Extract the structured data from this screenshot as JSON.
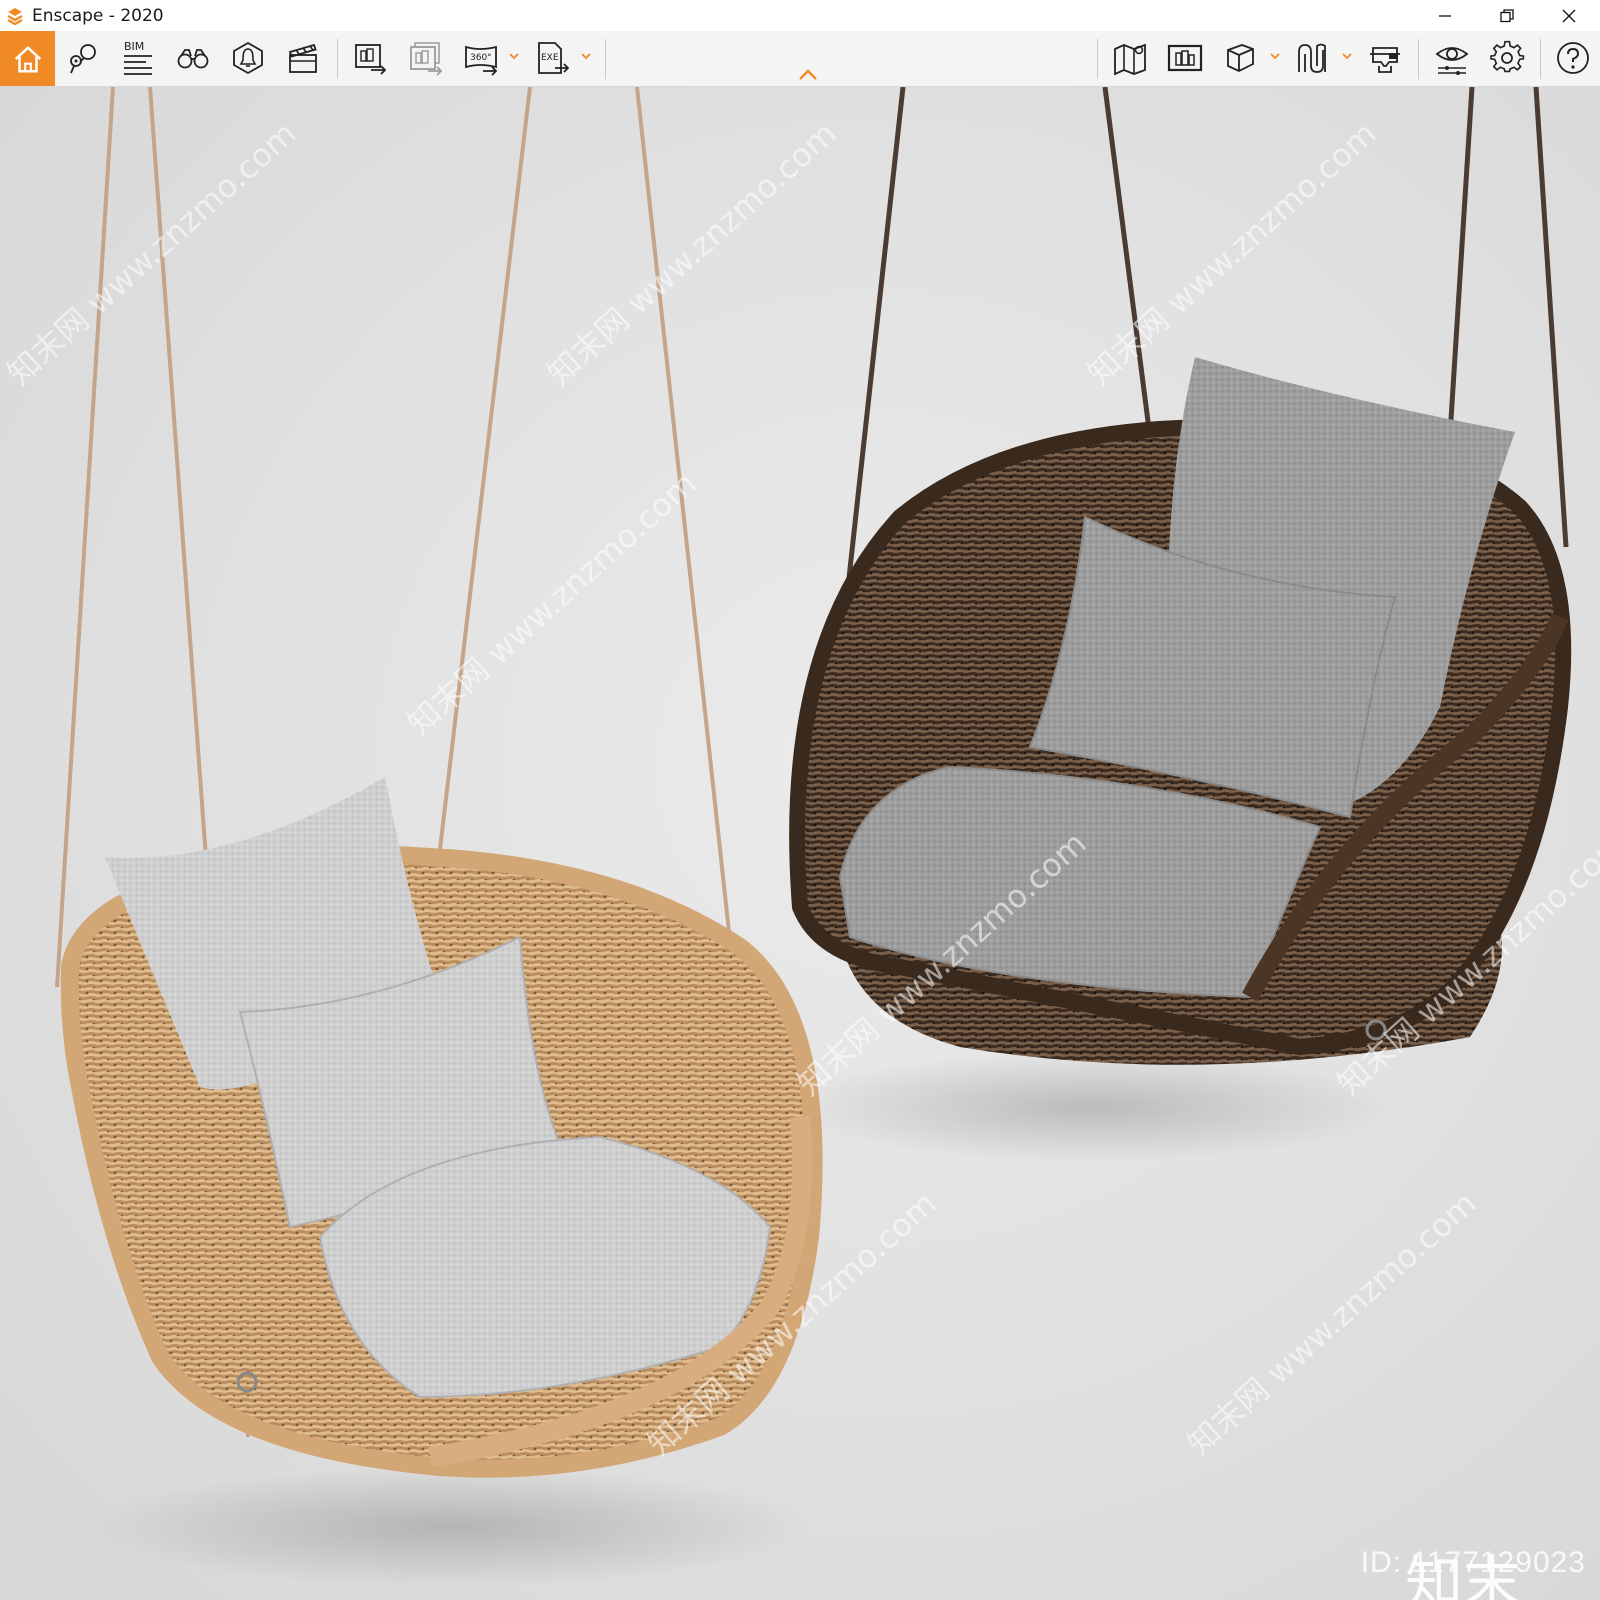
{
  "window": {
    "title": "Enscape - 2020",
    "minimize_icon": "minimize-icon",
    "restore_icon": "restore-icon",
    "close_icon": "close-icon"
  },
  "toolbar": {
    "accent_color": "#f08a24",
    "bim_label": "BIM",
    "pano_label": "360°",
    "exe_label": "EXE",
    "buttons": [
      {
        "name": "home-button",
        "icon": "home-icon"
      },
      {
        "name": "view-management-button",
        "icon": "location-pins-icon"
      },
      {
        "name": "bim-button",
        "icon": "bim-list-icon"
      },
      {
        "name": "walk-mode-button",
        "icon": "binoculars-icon"
      },
      {
        "name": "light-view-button",
        "icon": "light-bulb-icon"
      },
      {
        "name": "video-editor-button",
        "icon": "clapperboard-icon"
      },
      {
        "name": "render-image-button",
        "icon": "render-image-icon"
      },
      {
        "name": "batch-render-button",
        "icon": "batch-render-icon"
      },
      {
        "name": "render-panorama-button",
        "icon": "panorama-360-icon"
      },
      {
        "name": "export-exe-button",
        "icon": "exe-export-icon"
      },
      {
        "name": "map-button",
        "icon": "map-icon"
      },
      {
        "name": "capture-button",
        "icon": "capture-icon"
      },
      {
        "name": "asset-library-button",
        "icon": "cube-icon"
      },
      {
        "name": "materials-button",
        "icon": "materials-icon"
      },
      {
        "name": "vr-headset-button",
        "icon": "vr-headset-icon"
      },
      {
        "name": "visual-settings-button",
        "icon": "eye-icon"
      },
      {
        "name": "general-settings-button",
        "icon": "gear-icon"
      },
      {
        "name": "help-button",
        "icon": "help-icon"
      }
    ]
  },
  "viewport": {
    "watermark_text": "知末网 www.znzmo.com",
    "logo_text": "知末",
    "id_text": "ID: 1177129023"
  }
}
